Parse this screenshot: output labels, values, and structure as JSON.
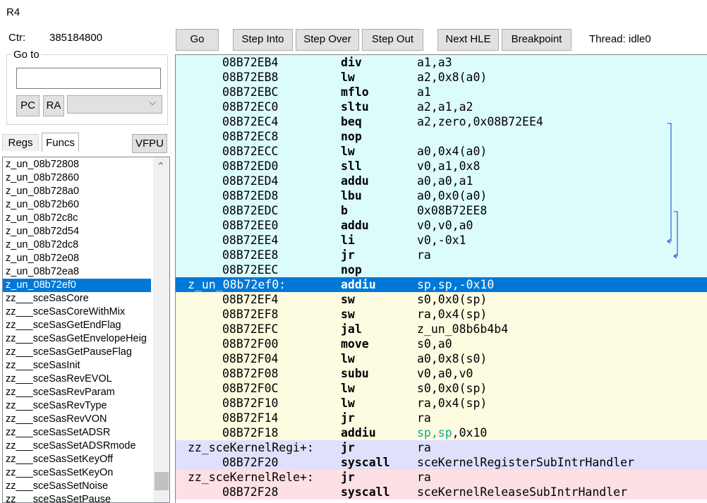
{
  "window": {
    "title": "R4"
  },
  "counter": {
    "label": "Ctr:",
    "value": "385184800"
  },
  "goto": {
    "legend": "Go to",
    "input_value": "",
    "pc_label": "PC",
    "ra_label": "RA",
    "select_value": ""
  },
  "tabs": {
    "regs": "Regs",
    "funcs": "Funcs",
    "vfpu": "VFPU"
  },
  "toolbar": {
    "go": "Go",
    "step_into": "Step Into",
    "step_over": "Step Over",
    "step_out": "Step Out",
    "next_hle": "Next HLE",
    "breakpoint": "Breakpoint",
    "thread": "Thread: idle0"
  },
  "functions": [
    "z_un_08b72808",
    "z_un_08b72860",
    "z_un_08b728a0",
    "z_un_08b72b60",
    "z_un_08b72c8c",
    "z_un_08b72d54",
    "z_un_08b72dc8",
    "z_un_08b72e08",
    "z_un_08b72ea8",
    "z_un_08b72ef0",
    "zz___sceSasCore",
    "zz___sceSasCoreWithMix",
    "zz___sceSasGetEndFlag",
    "zz___sceSasGetEnvelopeHeig",
    "zz___sceSasGetPauseFlag",
    "zz___sceSasInit",
    "zz___sceSasRevEVOL",
    "zz___sceSasRevParam",
    "zz___sceSasRevType",
    "zz___sceSasRevVON",
    "zz___sceSasSetADSR",
    "zz___sceSasSetADSRmode",
    "zz___sceSasSetKeyOff",
    "zz___sceSasSetKeyOn",
    "zz___sceSasSetNoise",
    "zz___sceSasSetPause"
  ],
  "selected_function": 9,
  "disassembly": [
    {
      "addr": "08B72EB4",
      "op": "div",
      "args": "a1,a3",
      "bg": "#dcfcfc"
    },
    {
      "addr": "08B72EB8",
      "op": "lw",
      "args": "a2,0x8(a0)",
      "bg": "#dcfcfc"
    },
    {
      "addr": "08B72EBC",
      "op": "mflo",
      "args": "a1",
      "bg": "#dcfcfc"
    },
    {
      "addr": "08B72EC0",
      "op": "sltu",
      "args": "a2,a1,a2",
      "bg": "#dcfcfc"
    },
    {
      "addr": "08B72EC4",
      "op": "beq",
      "args": "a2,zero,0x08B72EE4",
      "bg": "#dcfcfc"
    },
    {
      "addr": "08B72EC8",
      "op": "nop",
      "args": "",
      "bg": "#dcfcfc"
    },
    {
      "addr": "08B72ECC",
      "op": "lw",
      "args": "a0,0x4(a0)",
      "bg": "#dcfcfc"
    },
    {
      "addr": "08B72ED0",
      "op": "sll",
      "args": "v0,a1,0x8",
      "bg": "#dcfcfc"
    },
    {
      "addr": "08B72ED4",
      "op": "addu",
      "args": "a0,a0,a1",
      "bg": "#dcfcfc"
    },
    {
      "addr": "08B72ED8",
      "op": "lbu",
      "args": "a0,0x0(a0)",
      "bg": "#dcfcfc"
    },
    {
      "addr": "08B72EDC",
      "op": "b",
      "args": "0x08B72EE8",
      "bg": "#dcfcfc"
    },
    {
      "addr": "08B72EE0",
      "op": "addu",
      "args": "v0,v0,a0",
      "bg": "#dcfcfc"
    },
    {
      "addr": "08B72EE4",
      "op": "li",
      "args": "v0,-0x1",
      "bg": "#dcfcfc"
    },
    {
      "addr": "08B72EE8",
      "op": "jr",
      "args": "ra",
      "bg": "#dcfcfc"
    },
    {
      "addr": "08B72EEC",
      "op": "nop",
      "args": "",
      "bg": "#dcfcfc"
    },
    {
      "addr": "z_un_08b72ef0:",
      "op": "addiu",
      "args": "sp,sp,-0x10",
      "bg": "#0078d7",
      "label": true,
      "selected": true
    },
    {
      "addr": "08B72EF4",
      "op": "sw",
      "args": "s0,0x0(sp)",
      "bg": "#fdfbe0"
    },
    {
      "addr": "08B72EF8",
      "op": "sw",
      "args": "ra,0x4(sp)",
      "bg": "#fdfbe0"
    },
    {
      "addr": "08B72EFC",
      "op": "jal",
      "args": "z_un_08b6b4b4",
      "bg": "#fdfbe0"
    },
    {
      "addr": "08B72F00",
      "op": "move",
      "args": "s0,a0",
      "bg": "#fdfbe0"
    },
    {
      "addr": "08B72F04",
      "op": "lw",
      "args": "a0,0x8(s0)",
      "bg": "#fdfbe0"
    },
    {
      "addr": "08B72F08",
      "op": "subu",
      "args": "v0,a0,v0",
      "bg": "#fdfbe0"
    },
    {
      "addr": "08B72F0C",
      "op": "lw",
      "args": "s0,0x0(sp)",
      "bg": "#fdfbe0"
    },
    {
      "addr": "08B72F10",
      "op": "lw",
      "args": "ra,0x4(sp)",
      "bg": "#fdfbe0"
    },
    {
      "addr": "08B72F14",
      "op": "jr",
      "args": "ra",
      "bg": "#fdfbe0"
    },
    {
      "addr": "08B72F18",
      "op": "addiu",
      "args": "sp,sp,0x10",
      "bg": "#fdfbe0",
      "highlight": true
    },
    {
      "addr": "zz_sceKernelRegi+:",
      "op": "jr",
      "args": "ra",
      "bg": "#e0e0fc",
      "label": true
    },
    {
      "addr": "08B72F20",
      "op": "syscall",
      "args": "sceKernelRegisterSubIntrHandler",
      "bg": "#e0e0fc"
    },
    {
      "addr": "zz_sceKernelRele+:",
      "op": "jr",
      "args": "ra",
      "bg": "#fce0e4",
      "label": true
    },
    {
      "addr": "08B72F28",
      "op": "syscall",
      "args": "sceKernelReleaseSubIntrHandler",
      "bg": "#fce0e4"
    }
  ],
  "colors": {
    "branch_line": "#0a3cc8",
    "selection": "#0078d7",
    "highlight_reg": "#12a69a"
  }
}
